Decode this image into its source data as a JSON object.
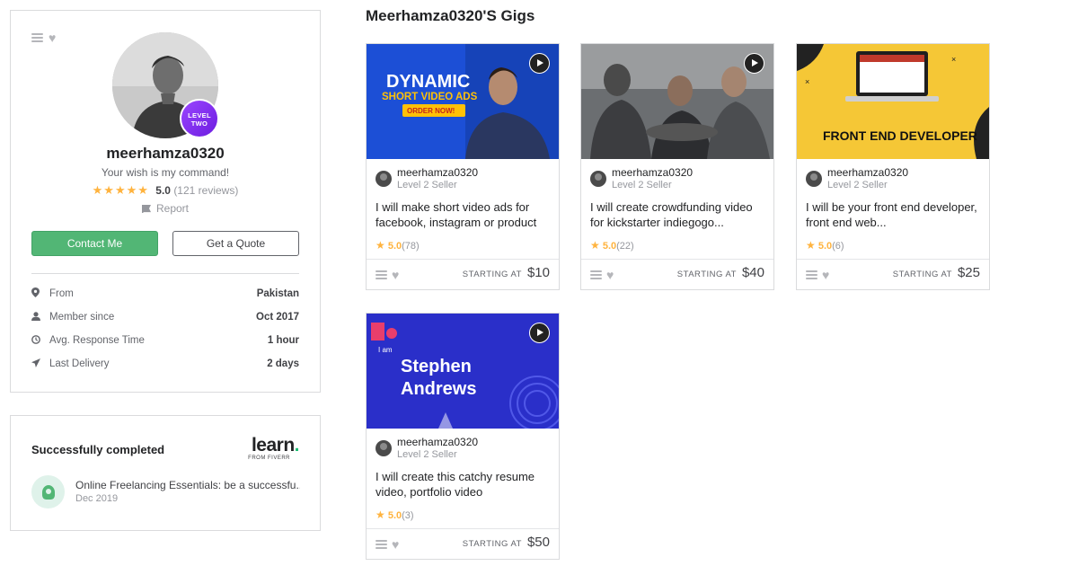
{
  "profile": {
    "username": "meerhamza0320",
    "level_line1": "LEVEL",
    "level_line2": "TWO",
    "tagline": "Your wish is my command!",
    "stars": "★★★★★",
    "rating": "5.0",
    "reviews": "(121 reviews)",
    "report": "Report",
    "contact_label": "Contact Me",
    "quote_label": "Get a Quote",
    "stats": [
      {
        "icon": "location-pin-icon",
        "label": "From",
        "value": "Pakistan"
      },
      {
        "icon": "user-icon",
        "label": "Member since",
        "value": "Oct 2017"
      },
      {
        "icon": "clock-icon",
        "label": "Avg. Response Time",
        "value": "1 hour"
      },
      {
        "icon": "paper-plane-icon",
        "label": "Last Delivery",
        "value": "2 days"
      }
    ]
  },
  "learn": {
    "title": "Successfully completed",
    "logo_word": "learn",
    "logo_dot": ".",
    "logo_sub": "FROM FIVERR",
    "course_name": "Online Freelancing Essentials: be a successfu...",
    "course_date": "Dec 2019"
  },
  "gigs_title": "Meerhamza0320'S Gigs",
  "gigs": [
    {
      "seller": "meerhamza0320",
      "level": "Level 2 Seller",
      "title": "I will make short video ads for facebook, instagram or product",
      "star": "★",
      "rating": "5.0",
      "count": "(78)",
      "starting": "STARTING AT",
      "price": "$10",
      "thumb_text1": "DYNAMIC",
      "thumb_text2": "SHORT VIDEO ADS",
      "thumb_text3": "ORDER NOW!"
    },
    {
      "seller": "meerhamza0320",
      "level": "Level 2 Seller",
      "title": "I will create crowdfunding video for kickstarter indiegogo...",
      "star": "★",
      "rating": "5.0",
      "count": "(22)",
      "starting": "STARTING AT",
      "price": "$40"
    },
    {
      "seller": "meerhamza0320",
      "level": "Level 2 Seller",
      "title": "I will be your front end developer, front end web...",
      "star": "★",
      "rating": "5.0",
      "count": "(6)",
      "starting": "STARTING AT",
      "price": "$25",
      "thumb_text1": "FRONT END DEVELOPER"
    },
    {
      "seller": "meerhamza0320",
      "level": "Level 2 Seller",
      "title": "I will create this catchy resume video, portfolio video",
      "star": "★",
      "rating": "5.0",
      "count": "(3)",
      "starting": "STARTING AT",
      "price": "$50",
      "thumb_text1": "I am",
      "thumb_text2": "Stephen",
      "thumb_text3": "Andrews"
    }
  ],
  "colors": {
    "green": "#52b675",
    "star": "#ffb33e",
    "level_badge": "#8a2be2"
  }
}
